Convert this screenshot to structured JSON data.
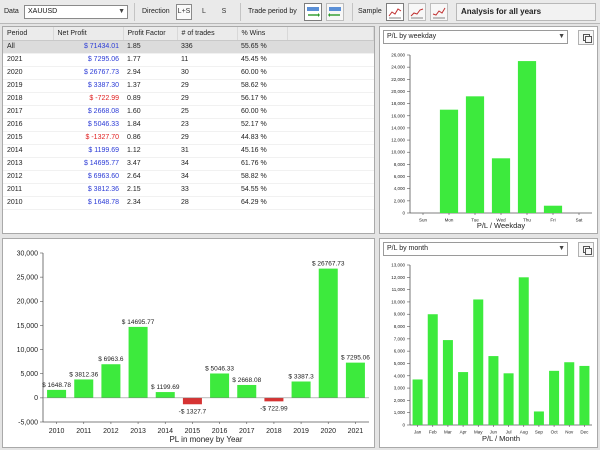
{
  "toolbar": {
    "data_label": "Data",
    "symbol": "XAUUSD",
    "direction_label": "Direction",
    "directions": [
      "L+S",
      "L",
      "S"
    ],
    "trade_period_label": "Trade period by",
    "sample_label": "Sample",
    "analysis_title": "Analysis for all years"
  },
  "table": {
    "headers": [
      "Period",
      "Net Profit",
      "Profit Factor",
      "# of trades",
      "% Wins"
    ],
    "rows": [
      {
        "period": "All",
        "net_profit": "$ 71434.01",
        "pf": "1.85",
        "trades": "336",
        "wins": "55.65 %",
        "neg": false
      },
      {
        "period": "2021",
        "net_profit": "$ 7295.06",
        "pf": "1.77",
        "trades": "11",
        "wins": "45.45 %",
        "neg": false
      },
      {
        "period": "2020",
        "net_profit": "$ 26767.73",
        "pf": "2.94",
        "trades": "30",
        "wins": "60.00 %",
        "neg": false
      },
      {
        "period": "2019",
        "net_profit": "$ 3387.30",
        "pf": "1.37",
        "trades": "29",
        "wins": "58.62 %",
        "neg": false
      },
      {
        "period": "2018",
        "net_profit": "$ -722.99",
        "pf": "0.89",
        "trades": "29",
        "wins": "56.17 %",
        "neg": true
      },
      {
        "period": "2017",
        "net_profit": "$ 2668.08",
        "pf": "1.60",
        "trades": "25",
        "wins": "60.00 %",
        "neg": false
      },
      {
        "period": "2016",
        "net_profit": "$ 5046.33",
        "pf": "1.84",
        "trades": "23",
        "wins": "52.17 %",
        "neg": false
      },
      {
        "period": "2015",
        "net_profit": "$ -1327.70",
        "pf": "0.86",
        "trades": "29",
        "wins": "44.83 %",
        "neg": true
      },
      {
        "period": "2014",
        "net_profit": "$ 1199.69",
        "pf": "1.12",
        "trades": "31",
        "wins": "45.16 %",
        "neg": false
      },
      {
        "period": "2013",
        "net_profit": "$ 14695.77",
        "pf": "3.47",
        "trades": "34",
        "wins": "61.76 %",
        "neg": false
      },
      {
        "period": "2012",
        "net_profit": "$ 6963.60",
        "pf": "2.64",
        "trades": "34",
        "wins": "58.82 %",
        "neg": false
      },
      {
        "period": "2011",
        "net_profit": "$ 3812.36",
        "pf": "2.15",
        "trades": "33",
        "wins": "54.55 %",
        "neg": false
      },
      {
        "period": "2010",
        "net_profit": "$ 1648.78",
        "pf": "2.34",
        "trades": "28",
        "wins": "64.29 %",
        "neg": false
      }
    ]
  },
  "weekday_panel": {
    "selector": "P/L by weekday"
  },
  "month_panel": {
    "selector": "P/L by month"
  },
  "colors": {
    "bar_positive": "#3dea3d",
    "bar_negative": "#d63333"
  },
  "chart_data": [
    {
      "type": "bar",
      "xlabel": "PL in money by Year",
      "categories": [
        "2010",
        "2011",
        "2012",
        "2013",
        "2014",
        "2015",
        "2016",
        "2017",
        "2018",
        "2019",
        "2020",
        "2021"
      ],
      "values": [
        1648.78,
        3812.36,
        6963.6,
        14695.77,
        1199.69,
        -1327.7,
        5046.33,
        2668.08,
        -722.99,
        3387.3,
        26767.73,
        7295.06
      ],
      "data_labels": [
        "$ 1648.78",
        "$ 3812.36",
        "$ 6963.6",
        "$ 14695.77",
        "$ 1199.69",
        "-$ 1327.7",
        "$ 5046.33",
        "$ 2668.08",
        "-$ 722.99",
        "$ 3387.3",
        "$ 26767.73",
        "$ 7295.06"
      ],
      "yticks": [
        -5000,
        0,
        5000,
        10000,
        15000,
        20000,
        25000,
        30000
      ],
      "ytick_labels": [
        "-5,000",
        "0",
        "5,000",
        "10,000",
        "15,000",
        "20,000",
        "25,000",
        "30,000"
      ],
      "ylim": [
        -5000,
        30000
      ],
      "grid": false
    },
    {
      "type": "bar",
      "xlabel": "P/L / Weekday",
      "categories": [
        "Sun",
        "Mon",
        "Tue",
        "Wed",
        "Thu",
        "Fri",
        "Sat"
      ],
      "values": [
        0,
        17000,
        19200,
        9000,
        25000,
        1200,
        0
      ],
      "yticks": [
        0,
        2000,
        4000,
        6000,
        8000,
        10000,
        12000,
        14000,
        16000,
        18000,
        20000,
        22000,
        24000,
        26000
      ],
      "ytick_labels": [
        "0",
        "2,000",
        "4,000",
        "6,000",
        "8,000",
        "10,000",
        "12,000",
        "14,000",
        "16,000",
        "18,000",
        "20,000",
        "22,000",
        "24,000",
        "26,000"
      ],
      "ylim": [
        0,
        26000
      ],
      "grid": false
    },
    {
      "type": "bar",
      "xlabel": "P/L / Month",
      "categories": [
        "Jan",
        "Feb",
        "Mar",
        "Apr",
        "May",
        "Jun",
        "Jul",
        "Aug",
        "Sep",
        "Oct",
        "Nov",
        "Dec"
      ],
      "values": [
        3700,
        9000,
        6900,
        4300,
        10200,
        5600,
        4200,
        12000,
        1100,
        4400,
        5100,
        4800
      ],
      "yticks": [
        0,
        1000,
        2000,
        3000,
        4000,
        5000,
        6000,
        7000,
        8000,
        9000,
        10000,
        11000,
        12000,
        13000
      ],
      "ytick_labels": [
        "0",
        "1,000",
        "2,000",
        "3,000",
        "4,000",
        "5,000",
        "6,000",
        "7,000",
        "8,000",
        "9,000",
        "10,000",
        "11,000",
        "12,000",
        "13,000"
      ],
      "ylim": [
        0,
        13000
      ],
      "grid": false
    }
  ]
}
